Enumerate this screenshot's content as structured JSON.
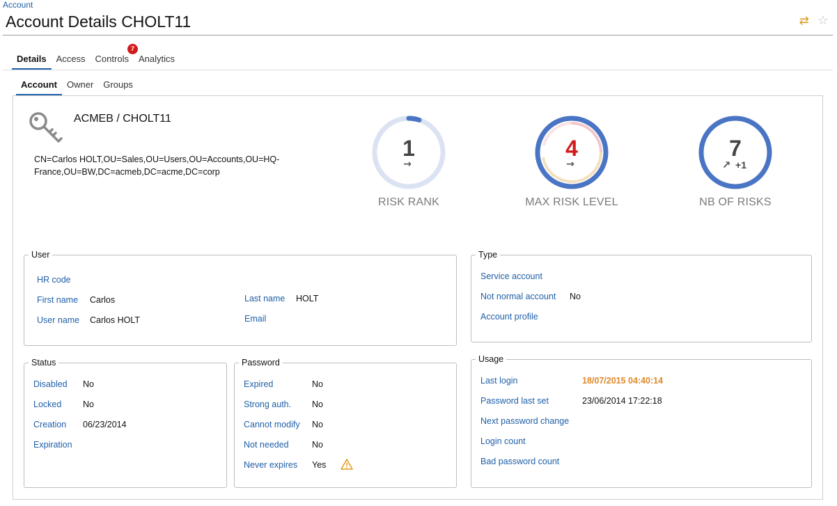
{
  "breadcrumb": "Account",
  "title": "Account Details CHOLT11",
  "header_icons": [
    "sync-icon",
    "star-icon"
  ],
  "tabs": [
    {
      "label": "Details",
      "active": true
    },
    {
      "label": "Access",
      "active": false
    },
    {
      "label": "Controls",
      "active": false,
      "badge": "7"
    },
    {
      "label": "Analytics",
      "active": false
    }
  ],
  "subtabs": [
    {
      "label": "Account",
      "active": true
    },
    {
      "label": "Owner",
      "active": false
    },
    {
      "label": "Groups",
      "active": false
    }
  ],
  "account": {
    "icon": "key-icon",
    "name": "ACMEB / CHOLT11",
    "dn": "CN=Carlos HOLT,OU=Sales,OU=Users,OU=Accounts,OU=HQ-France,OU=BW,DC=acmeb,DC=acme,DC=corp"
  },
  "gauges": {
    "risk_rank": {
      "value": "1",
      "trend": "→",
      "label": "RISK RANK"
    },
    "max_risk_level": {
      "value": "4",
      "trend": "→",
      "label": "MAX RISK LEVEL"
    },
    "nb_of_risks": {
      "value": "7",
      "trend": "↗",
      "delta": "+1",
      "label": "NB OF RISKS"
    }
  },
  "colors": {
    "link": "#1f5fa8",
    "gauge_ring": "#4a74c4",
    "gauge_ring_light": "#dbe3f2",
    "risk_red": "#d11b1b",
    "orange": "#e0892b"
  },
  "user": {
    "legend": "User",
    "hr_code_label": "HR code",
    "first_name_label": "First name",
    "first_name": "Carlos",
    "user_name_label": "User name",
    "user_name": "Carlos HOLT",
    "last_name_label": "Last name",
    "last_name": "HOLT",
    "email_label": "Email"
  },
  "type": {
    "legend": "Type",
    "service_account_label": "Service account",
    "not_normal_label": "Not normal account",
    "not_normal": "No",
    "account_profile_label": "Account profile"
  },
  "status": {
    "legend": "Status",
    "disabled_label": "Disabled",
    "disabled": "No",
    "locked_label": "Locked",
    "locked": "No",
    "creation_label": "Creation",
    "creation": "06/23/2014",
    "expiration_label": "Expiration"
  },
  "password": {
    "legend": "Password",
    "expired_label": "Expired",
    "expired": "No",
    "strong_label": "Strong auth.",
    "strong": "No",
    "cannot_modify_label": "Cannot modify",
    "cannot_modify": "No",
    "not_needed_label": "Not needed",
    "not_needed": "No",
    "never_expires_label": "Never expires",
    "never_expires": "Yes"
  },
  "usage": {
    "legend": "Usage",
    "last_login_label": "Last login",
    "last_login": "18/07/2015 04:40:14",
    "pwd_last_set_label": "Password last set",
    "pwd_last_set": "23/06/2014 17:22:18",
    "next_pwd_change_label": "Next password change",
    "login_count_label": "Login count",
    "bad_pwd_count_label": "Bad password count"
  }
}
